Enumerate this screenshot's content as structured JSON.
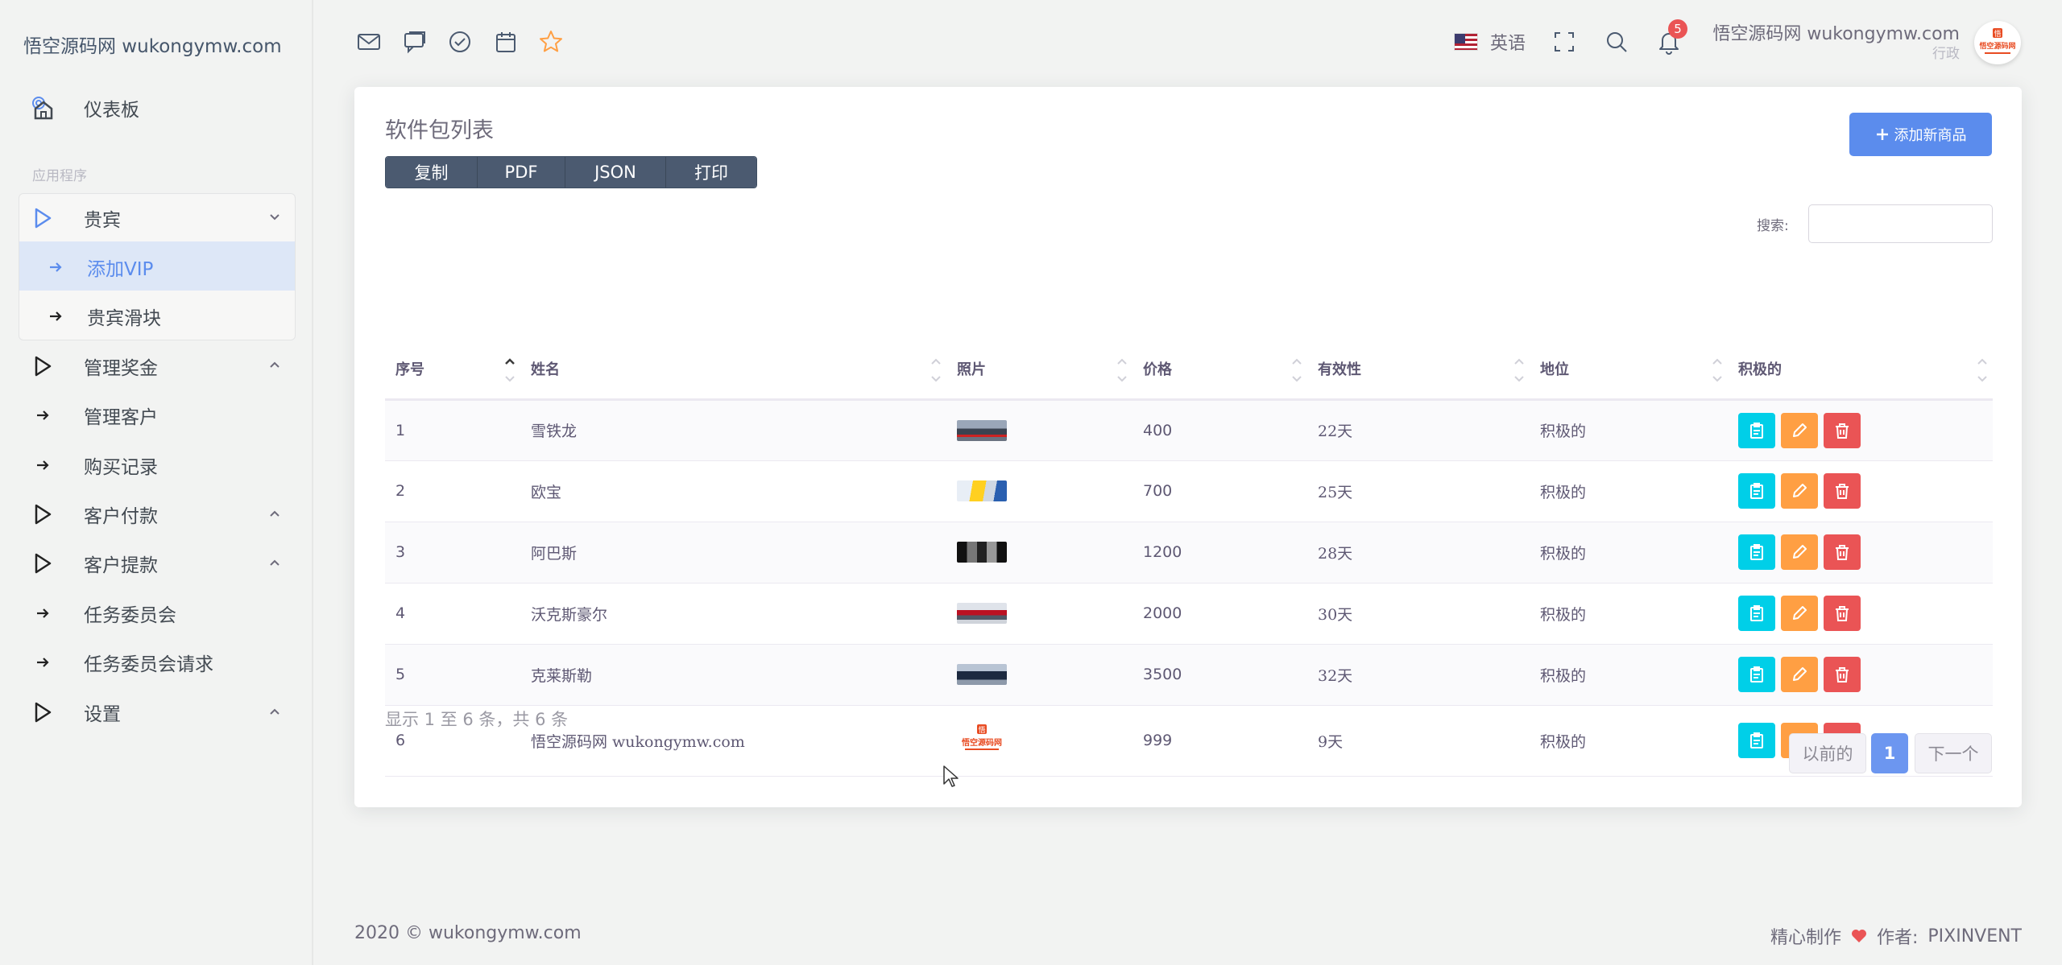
{
  "brand": "悟空源码网 wukongymw.com",
  "sidebar": {
    "dashboard": "仪表板",
    "section_label": "应用程序",
    "items": [
      {
        "label": "贵宾",
        "icon": "play-outline-icon"
      },
      {
        "label": "添加VIP",
        "icon": "arrow-right-icon"
      },
      {
        "label": "贵宾滑块",
        "icon": "arrow-right-icon"
      },
      {
        "label": "管理奖金",
        "icon": "play-outline-icon"
      },
      {
        "label": "管理客户",
        "icon": "arrow-right-icon"
      },
      {
        "label": "购买记录",
        "icon": "arrow-right-icon"
      },
      {
        "label": "客户付款",
        "icon": "play-outline-icon"
      },
      {
        "label": "客户提款",
        "icon": "play-outline-icon"
      },
      {
        "label": "任务委员会",
        "icon": "arrow-right-icon"
      },
      {
        "label": "任务委员会请求",
        "icon": "arrow-right-icon"
      },
      {
        "label": "设置",
        "icon": "play-outline-icon"
      }
    ]
  },
  "topbar": {
    "language": "英语",
    "notification_count": "5",
    "user_name": "悟空源码网 wukongymw.com",
    "user_role": "行政",
    "avatar_text": "悟空源码网"
  },
  "card": {
    "title": "软件包列表",
    "export_buttons": [
      "复制",
      "PDF",
      "JSON",
      "打印"
    ],
    "add_button": "添加新商品",
    "search_label": "搜索:",
    "search_value": ""
  },
  "table": {
    "columns": [
      "序号",
      "姓名",
      "照片",
      "价格",
      "有效性",
      "地位",
      "积极的"
    ],
    "rows": [
      {
        "id": "1",
        "name": "雪铁龙",
        "price": "400",
        "validity": "22天",
        "status": "积极的"
      },
      {
        "id": "2",
        "name": "欧宝",
        "price": "700",
        "validity": "25天",
        "status": "积极的"
      },
      {
        "id": "3",
        "name": "阿巴斯",
        "price": "1200",
        "validity": "28天",
        "status": "积极的"
      },
      {
        "id": "4",
        "name": "沃克斯豪尔",
        "price": "2000",
        "validity": "30天",
        "status": "积极的"
      },
      {
        "id": "5",
        "name": "克莱斯勒",
        "price": "3500",
        "validity": "32天",
        "status": "积极的"
      },
      {
        "id": "6",
        "name": "悟空源码网 wukongymw.com",
        "price": "999",
        "validity": "9天",
        "status": "积极的"
      }
    ]
  },
  "pagination": {
    "info": "显示 1 至 6 条，共 6 条",
    "prev": "以前的",
    "current": "1",
    "next": "下一个"
  },
  "footer": {
    "copyright": "2020 © wukongymw.com",
    "made_with": "精心制作",
    "author_label": "作者:",
    "author": "PIXINVENT"
  },
  "colors": {
    "primary": "#5b8ced",
    "info": "#00cfe8",
    "warning": "#ff9f43",
    "danger": "#ea5455"
  }
}
